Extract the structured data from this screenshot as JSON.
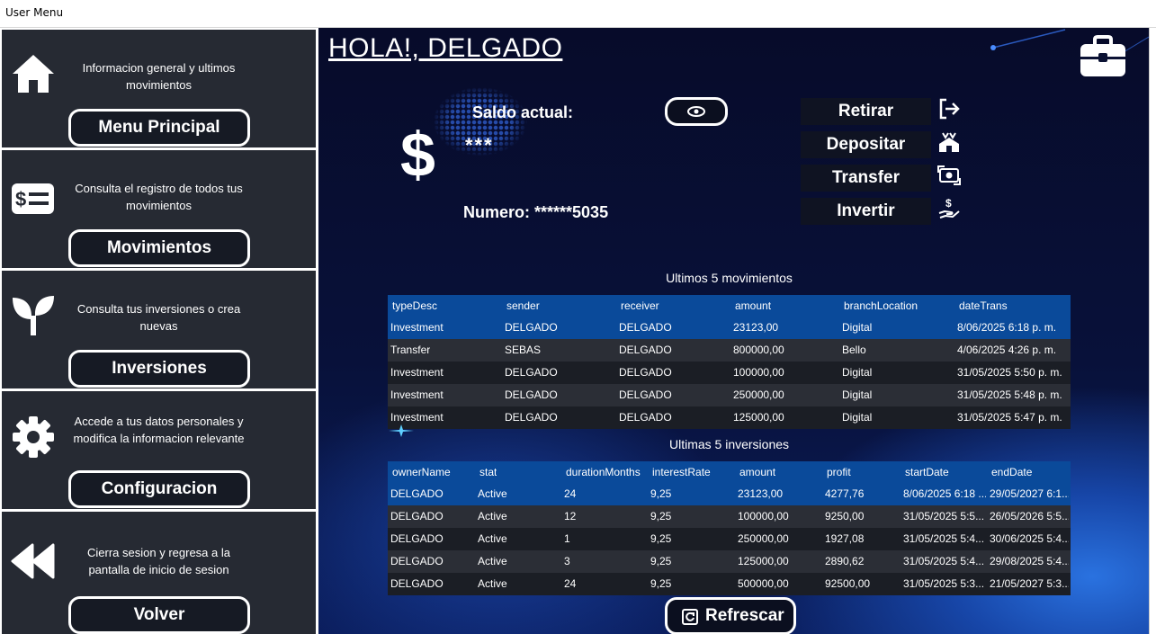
{
  "window": {
    "title": "User Menu"
  },
  "sidebar": {
    "items": [
      {
        "icon": "home-icon",
        "description": "Informacion general y ultimos movimientos",
        "button": "Menu Principal"
      },
      {
        "icon": "money-list-icon",
        "description": "Consulta el registro de todos tus movimientos",
        "button": "Movimientos"
      },
      {
        "icon": "sprout-icon",
        "description": "Consulta tus inversiones o crea nuevas",
        "button": "Inversiones"
      },
      {
        "icon": "gear-icon",
        "description": "Accede a tus datos personales y modifica la informacion relevante",
        "button": "Configuracion"
      },
      {
        "icon": "rewind-icon",
        "description": "Cierra sesion y regresa a la pantalla de inicio de sesion",
        "button": "Volver"
      }
    ]
  },
  "main": {
    "greeting": "HOLA!, DELGADO",
    "balance": {
      "label": "Saldo actual:",
      "value": "***",
      "currency_symbol": "$"
    },
    "account_number": "Numero: ******5035",
    "actions": [
      {
        "label": "Retirar",
        "icon": "logout-arrow-icon"
      },
      {
        "label": "Depositar",
        "icon": "deposit-house-icon"
      },
      {
        "label": "Transfer",
        "icon": "money-transfer-icon"
      },
      {
        "label": "Invertir",
        "icon": "hand-dollar-icon"
      }
    ],
    "movements": {
      "title": "Ultimos 5 movimientos",
      "columns": [
        "typeDesc",
        "sender",
        "receiver",
        "amount",
        "branchLocation",
        "dateTrans"
      ],
      "rows": [
        [
          "Investment",
          "DELGADO",
          "DELGADO",
          "23123,00",
          "Digital",
          "8/06/2025 6:18 p. m."
        ],
        [
          "Transfer",
          "SEBAS",
          "DELGADO",
          "800000,00",
          "Bello",
          "4/06/2025 4:26 p. m."
        ],
        [
          "Investment",
          "DELGADO",
          "DELGADO",
          "100000,00",
          "Digital",
          "31/05/2025 5:50 p. m."
        ],
        [
          "Investment",
          "DELGADO",
          "DELGADO",
          "250000,00",
          "Digital",
          "31/05/2025 5:48 p. m."
        ],
        [
          "Investment",
          "DELGADO",
          "DELGADO",
          "125000,00",
          "Digital",
          "31/05/2025 5:47 p. m."
        ]
      ]
    },
    "investments": {
      "title": "Ultimas 5 inversiones",
      "columns": [
        "ownerName",
        "stat",
        "durationMonths",
        "interestRate",
        "amount",
        "profit",
        "startDate",
        "endDate"
      ],
      "rows": [
        [
          "DELGADO",
          "Active",
          "24",
          "9,25",
          "23123,00",
          "4277,76",
          "8/06/2025 6:18 ...",
          "29/05/2027 6:1..."
        ],
        [
          "DELGADO",
          "Active",
          "12",
          "9,25",
          "100000,00",
          "9250,00",
          "31/05/2025 5:5...",
          "26/05/2026 5:5..."
        ],
        [
          "DELGADO",
          "Active",
          "1",
          "9,25",
          "250000,00",
          "1927,08",
          "31/05/2025 5:4...",
          "30/06/2025 5:4..."
        ],
        [
          "DELGADO",
          "Active",
          "3",
          "9,25",
          "125000,00",
          "2890,62",
          "31/05/2025 5:4...",
          "29/08/2025 5:4..."
        ],
        [
          "DELGADO",
          "Active",
          "24",
          "9,25",
          "500000,00",
          "92500,00",
          "31/05/2025 5:3...",
          "21/05/2027 5:3..."
        ]
      ]
    },
    "refresh_label": "Refrescar"
  }
}
